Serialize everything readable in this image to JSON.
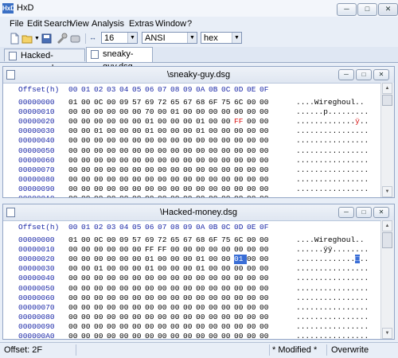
{
  "app": {
    "title": "HxD",
    "icon_text": "HxD"
  },
  "menu": [
    "File",
    "Edit",
    "Search",
    "View",
    "Analysis",
    "Extras",
    "Window",
    "?"
  ],
  "toolbar": {
    "bytes_per_row": "16",
    "charset": "ANSI",
    "offset_base": "hex"
  },
  "tabs": [
    {
      "label": "Hacked-money.dsg",
      "active": false
    },
    {
      "label": "sneaky-guy.dsg",
      "active": true
    }
  ],
  "editor_header": {
    "offset_label": "Offset(h)",
    "columns": [
      "00",
      "01",
      "02",
      "03",
      "04",
      "05",
      "06",
      "07",
      "08",
      "09",
      "0A",
      "0B",
      "0C",
      "0D",
      "0E",
      "0F"
    ]
  },
  "windows": [
    {
      "title": "\\sneaky-guy.dsg",
      "rows": [
        {
          "offset": "00000000",
          "bytes": [
            "01",
            "00",
            "0C",
            "00",
            "09",
            "57",
            "69",
            "72",
            "65",
            "67",
            "68",
            "6F",
            "75",
            "6C",
            "00",
            "00"
          ],
          "ascii": "....Wireghoul.."
        },
        {
          "offset": "00000010",
          "bytes": [
            "00",
            "00",
            "00",
            "00",
            "00",
            "00",
            "70",
            "00",
            "01",
            "00",
            "00",
            "00",
            "00",
            "00",
            "00",
            "00"
          ],
          "ascii": "......p........."
        },
        {
          "offset": "00000020",
          "bytes": [
            "00",
            "00",
            "00",
            "00",
            "00",
            "00",
            "01",
            "00",
            "00",
            "00",
            "01",
            "00",
            "00",
            "FF",
            "00",
            "00"
          ],
          "ascii": ".............ÿ..",
          "red_index": 13
        },
        {
          "offset": "00000030",
          "bytes": [
            "00",
            "00",
            "01",
            "00",
            "00",
            "00",
            "01",
            "00",
            "00",
            "00",
            "01",
            "00",
            "00",
            "00",
            "00",
            "00"
          ],
          "ascii": "................"
        },
        {
          "offset": "00000040",
          "bytes": [
            "00",
            "00",
            "00",
            "00",
            "00",
            "00",
            "00",
            "00",
            "00",
            "00",
            "00",
            "00",
            "00",
            "00",
            "00",
            "00"
          ],
          "ascii": "................"
        },
        {
          "offset": "00000050",
          "bytes": [
            "00",
            "00",
            "00",
            "00",
            "00",
            "00",
            "00",
            "00",
            "00",
            "00",
            "00",
            "00",
            "00",
            "00",
            "00",
            "00"
          ],
          "ascii": "................"
        },
        {
          "offset": "00000060",
          "bytes": [
            "00",
            "00",
            "00",
            "00",
            "00",
            "00",
            "00",
            "00",
            "00",
            "00",
            "00",
            "00",
            "00",
            "00",
            "00",
            "00"
          ],
          "ascii": "................"
        },
        {
          "offset": "00000070",
          "bytes": [
            "00",
            "00",
            "00",
            "00",
            "00",
            "00",
            "00",
            "00",
            "00",
            "00",
            "00",
            "00",
            "00",
            "00",
            "00",
            "00"
          ],
          "ascii": "................"
        },
        {
          "offset": "00000080",
          "bytes": [
            "00",
            "00",
            "00",
            "00",
            "00",
            "00",
            "00",
            "00",
            "00",
            "00",
            "00",
            "00",
            "00",
            "00",
            "00",
            "00"
          ],
          "ascii": "................"
        },
        {
          "offset": "00000090",
          "bytes": [
            "00",
            "00",
            "00",
            "00",
            "00",
            "00",
            "00",
            "00",
            "00",
            "00",
            "00",
            "00",
            "00",
            "00",
            "00",
            "00"
          ],
          "ascii": "................"
        },
        {
          "offset": "000000A0",
          "bytes": [
            "00",
            "00",
            "00",
            "00",
            "00",
            "00",
            "00",
            "00",
            "00",
            "00",
            "00",
            "00",
            "00",
            "00",
            "00",
            "00"
          ],
          "ascii": "................"
        }
      ]
    },
    {
      "title": "\\Hacked-money.dsg",
      "rows": [
        {
          "offset": "00000000",
          "bytes": [
            "01",
            "00",
            "0C",
            "00",
            "09",
            "57",
            "69",
            "72",
            "65",
            "67",
            "68",
            "6F",
            "75",
            "6C",
            "00",
            "00"
          ],
          "ascii": "....Wireghoul.."
        },
        {
          "offset": "00000010",
          "bytes": [
            "00",
            "00",
            "00",
            "00",
            "00",
            "00",
            "FF",
            "FF",
            "00",
            "00",
            "00",
            "00",
            "00",
            "00",
            "00",
            "00"
          ],
          "ascii": "......ÿÿ........"
        },
        {
          "offset": "00000020",
          "bytes": [
            "00",
            "00",
            "00",
            "00",
            "00",
            "00",
            "01",
            "00",
            "00",
            "00",
            "01",
            "00",
            "00",
            "01",
            "00",
            "00"
          ],
          "ascii": ".............□..",
          "selected_index": 13
        },
        {
          "offset": "00000030",
          "bytes": [
            "00",
            "00",
            "01",
            "00",
            "00",
            "00",
            "01",
            "00",
            "00",
            "00",
            "01",
            "00",
            "00",
            "00",
            "00",
            "00"
          ],
          "ascii": "................"
        },
        {
          "offset": "00000040",
          "bytes": [
            "00",
            "00",
            "00",
            "00",
            "00",
            "00",
            "00",
            "00",
            "00",
            "00",
            "00",
            "00",
            "00",
            "00",
            "00",
            "00"
          ],
          "ascii": "................"
        },
        {
          "offset": "00000050",
          "bytes": [
            "00",
            "00",
            "00",
            "00",
            "00",
            "00",
            "00",
            "00",
            "00",
            "00",
            "00",
            "00",
            "00",
            "00",
            "00",
            "00"
          ],
          "ascii": "................"
        },
        {
          "offset": "00000060",
          "bytes": [
            "00",
            "00",
            "00",
            "00",
            "00",
            "00",
            "00",
            "00",
            "00",
            "00",
            "00",
            "00",
            "00",
            "00",
            "00",
            "00"
          ],
          "ascii": "................"
        },
        {
          "offset": "00000070",
          "bytes": [
            "00",
            "00",
            "00",
            "00",
            "00",
            "00",
            "00",
            "00",
            "00",
            "00",
            "00",
            "00",
            "00",
            "00",
            "00",
            "00"
          ],
          "ascii": "................"
        },
        {
          "offset": "00000080",
          "bytes": [
            "00",
            "00",
            "00",
            "00",
            "00",
            "00",
            "00",
            "00",
            "00",
            "00",
            "00",
            "00",
            "00",
            "00",
            "00",
            "00"
          ],
          "ascii": "................"
        },
        {
          "offset": "00000090",
          "bytes": [
            "00",
            "00",
            "00",
            "00",
            "00",
            "00",
            "00",
            "00",
            "00",
            "00",
            "00",
            "00",
            "00",
            "00",
            "00",
            "00"
          ],
          "ascii": "................"
        },
        {
          "offset": "000000A0",
          "bytes": [
            "00",
            "00",
            "00",
            "00",
            "00",
            "00",
            "00",
            "00",
            "00",
            "00",
            "00",
            "00",
            "00",
            "00",
            "00",
            "00"
          ],
          "ascii": "................"
        }
      ]
    }
  ],
  "status": {
    "offset": "Offset: 2F",
    "modified": "* Modified *",
    "mode": "Overwrite"
  },
  "colors": {
    "accent": "#3a6ed6",
    "offset_text": "#1d2aa8",
    "changed_byte": "#d81010"
  }
}
